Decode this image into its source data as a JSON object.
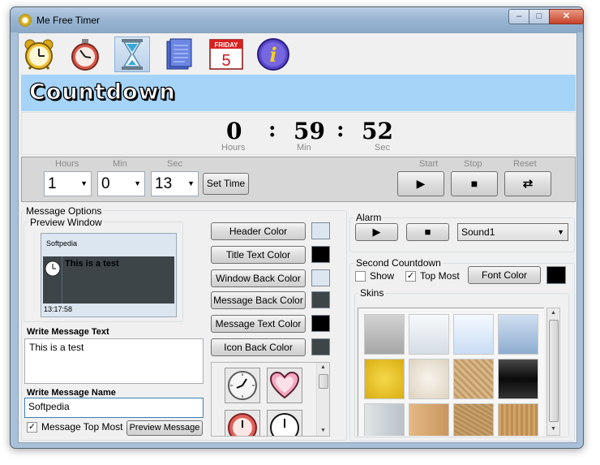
{
  "window": {
    "title": "Me Free Timer",
    "minimize": "–",
    "maximize": "□",
    "close": "✕"
  },
  "toolbar": {
    "icons": [
      "alarm-clock-icon",
      "stopwatch-icon",
      "hourglass-icon",
      "notepad-icon",
      "calendar-icon",
      "info-icon"
    ],
    "calendar_month": "FRIDAY",
    "calendar_day": "5",
    "info_glyph": "i"
  },
  "banner": {
    "title": "Countdown"
  },
  "display": {
    "hours": "0",
    "min": "59",
    "sec": "52",
    "colon": ":",
    "hours_label": "Hours",
    "min_label": "Min",
    "sec_label": "Sec"
  },
  "controls": {
    "hours_label": "Hours",
    "min_label": "Min",
    "sec_label": "Sec",
    "hours_value": "1",
    "min_value": "0",
    "sec_value": "13",
    "set_time": "Set Time",
    "start_label": "Start",
    "stop_label": "Stop",
    "reset_label": "Reset",
    "start_glyph": "▶",
    "stop_glyph": "■",
    "reset_glyph": "⇄"
  },
  "message_options": {
    "group_label": "Message Options",
    "preview_label": "Preview Window",
    "preview": {
      "title": "Softpedia",
      "message": "This is a test",
      "time": "13:17:58"
    },
    "write_text_label": "Write Message Text",
    "message_text": "This is a test",
    "write_name_label": "Write Message Name",
    "message_name": "Softpedia",
    "top_most_label": "Message Top Most",
    "top_most_checked": "✓",
    "preview_button": "Preview Message",
    "color_buttons": [
      "Header Color",
      "Title Text Color",
      "Window Back Color",
      "Message Back Color",
      "Message Text Color",
      "Icon Back Color"
    ],
    "color_swatches": [
      "#dce6f1",
      "#000000",
      "#dce6f1",
      "#3d4549",
      "#000000",
      "#3d4549"
    ],
    "icons": [
      "wall-clock-icon",
      "heart-icon",
      "red-clock-icon",
      "plain-clock-icon"
    ]
  },
  "alarm": {
    "group_label": "Alarm",
    "sound": "Sound1",
    "play_glyph": "▶",
    "stop_glyph": "■"
  },
  "second_countdown": {
    "group_label": "Second Countdown",
    "show_label": "Show",
    "top_most_label": "Top Most",
    "top_most_checked": "✓",
    "font_color_button": "Font Color",
    "font_color_swatch": "#000000"
  },
  "skins": {
    "group_label": "Skins",
    "tiles": [
      "#b9b9b9",
      "#e4e9ee",
      "#d9e8f8",
      "#a9c2dc",
      "#e8c320",
      "#ece6db",
      "#ccab7d",
      "#1b1b1b",
      "#c9d1d6",
      "#d6a875",
      "#c49e68",
      "#c89a60"
    ]
  }
}
